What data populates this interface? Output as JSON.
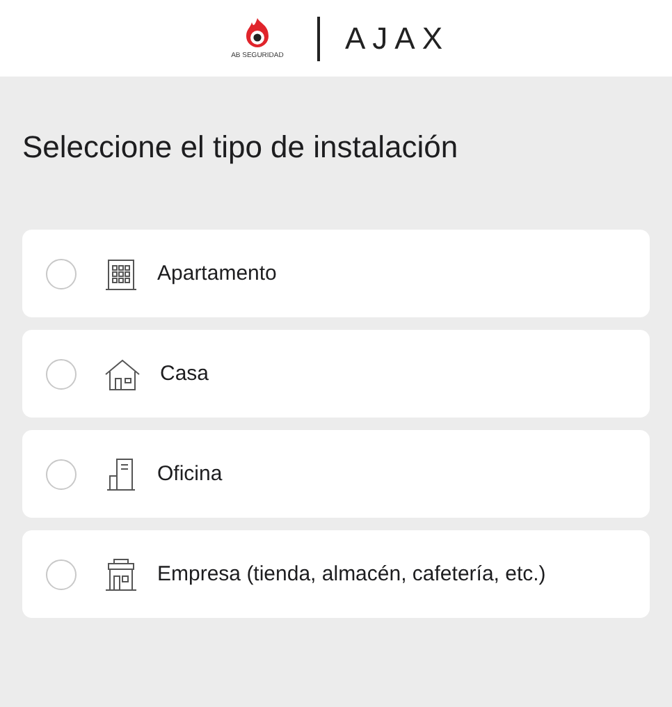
{
  "header": {
    "brand_left": "AB SEGURIDAD",
    "brand_right": "AJAX"
  },
  "title": "Seleccione el tipo de instalación",
  "options": [
    {
      "kind": "apartment",
      "label": "Apartamento",
      "selected": false
    },
    {
      "kind": "house",
      "label": "Casa",
      "selected": false
    },
    {
      "kind": "office",
      "label": "Oficina",
      "selected": false
    },
    {
      "kind": "shop",
      "label": "Empresa (tienda, almacén, cafetería, etc.)",
      "selected": false
    }
  ]
}
